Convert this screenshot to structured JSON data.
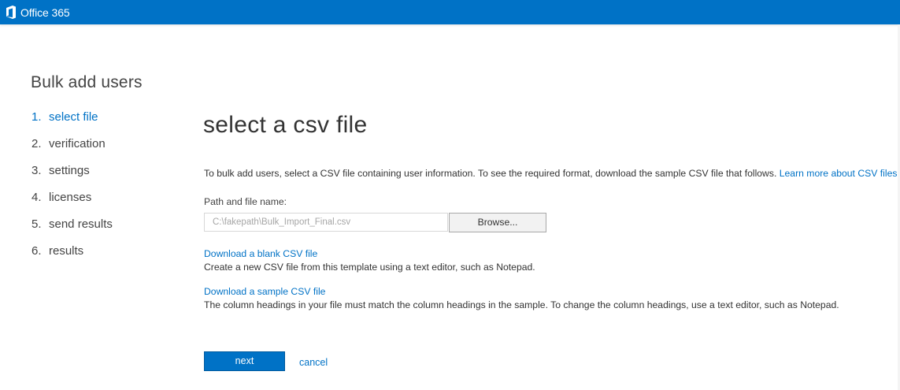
{
  "header": {
    "app_name": "Office 365",
    "logo_icon": "office-logo-icon",
    "bar_color": "#0072c6"
  },
  "sidebar": {
    "title": "Bulk add users",
    "steps": [
      {
        "number": "1.",
        "label": "select file",
        "active": true
      },
      {
        "number": "2.",
        "label": "verification",
        "active": false
      },
      {
        "number": "3.",
        "label": "settings",
        "active": false
      },
      {
        "number": "4.",
        "label": "licenses",
        "active": false
      },
      {
        "number": "5.",
        "label": "send results",
        "active": false
      },
      {
        "number": "6.",
        "label": "results",
        "active": false
      }
    ]
  },
  "main": {
    "heading": "select a csv file",
    "intro_text": "To bulk add users, select a CSV file containing user information. To see the required format, download the sample CSV file that follows. ",
    "learn_more_link": "Learn more about CSV files",
    "path_label": "Path and file name:",
    "path_value": "C:\\fakepath\\Bulk_Import_Final.csv",
    "browse_label": "Browse...",
    "blank_csv": {
      "link": "Download a blank CSV file",
      "description": "Create a new CSV file from this template using a text editor, such as Notepad."
    },
    "sample_csv": {
      "link": "Download a sample CSV file",
      "description": "The column headings in your file must match the column headings in the sample. To change the column headings, use a text editor, such as Notepad."
    }
  },
  "footer": {
    "next_label": "next",
    "cancel_label": "cancel"
  },
  "colors": {
    "accent": "#0072c6",
    "text": "#333333"
  }
}
